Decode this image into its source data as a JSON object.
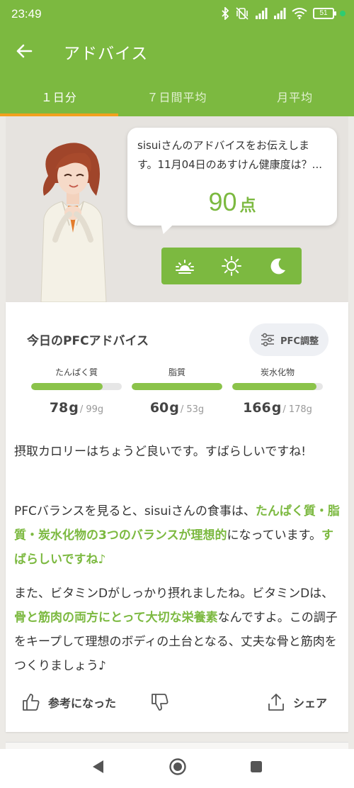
{
  "status": {
    "time": "23:49",
    "battery": "51"
  },
  "appbar": {
    "title": "アドバイス"
  },
  "tabs": [
    {
      "label": "１日分"
    },
    {
      "label": "７日間平均"
    },
    {
      "label": "月平均"
    }
  ],
  "advice": {
    "message": "sisuiさんのアドバイスをお伝えします。11月04日のあすけん健康度は？...",
    "score": "90",
    "score_unit": "点"
  },
  "pfc": {
    "heading": "今日のPFCアドバイス",
    "button_label": "PFC調整",
    "nutrients": [
      {
        "label": "たんぱく質",
        "value": "78",
        "unit": "g",
        "target": "/ 99g",
        "progress": 0.79
      },
      {
        "label": "脂質",
        "value": "60",
        "unit": "g",
        "target": "/ 53g",
        "progress": 1.0
      },
      {
        "label": "炭水化物",
        "value": "166",
        "unit": "g",
        "target": "/ 178g",
        "progress": 0.93
      }
    ]
  },
  "paragraphs": {
    "p1": "摂取カロリーはちょうど良いです。すばらしいですね!",
    "p2_a": "PFCバランスを見ると、sisuiさんの食事は、",
    "p2_hl": "たんぱく質・脂質・炭水化物の3つのバランスが理想的",
    "p2_b": "になっています。",
    "p2_hl2": "すばらしいですね♪",
    "p3_a": "また、ビタミンDがしっかり摂れましたね。ビタミンDは、",
    "p3_hl": "骨と筋肉の両方にとって大切な栄養素",
    "p3_b": "なんですよ。この調子をキープして理想のボディの土台となる、丈夫な骨と筋肉をつくりましょう♪"
  },
  "actions": {
    "helpful": "参考になった",
    "share": "シェア"
  },
  "colors": {
    "brand_green": "#7cb940",
    "tab_indicator": "#f2a01e",
    "bar_fill": "#8bc34a"
  }
}
